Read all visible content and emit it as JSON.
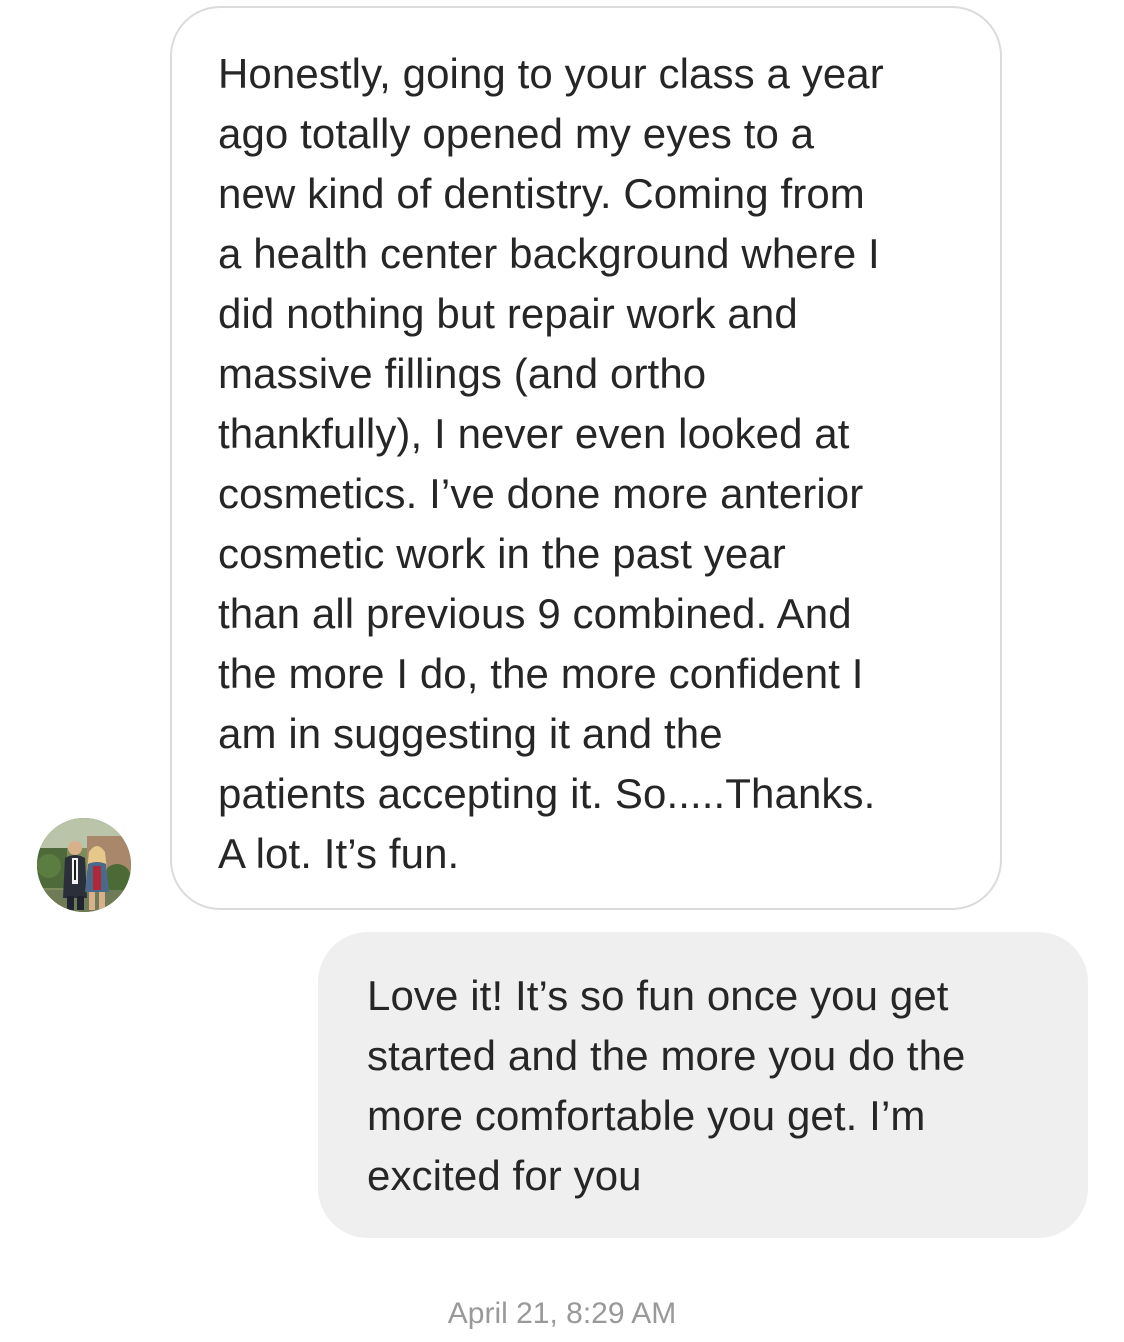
{
  "thread": {
    "incoming_message": {
      "text": "Honestly, going to your class a year\nago totally opened my eyes to a\nnew kind of dentistry. Coming from\na health center background where I\ndid nothing but repair work and\nmassive fillings (and ortho\nthankfully), I never even looked at\ncosmetics. I’ve done more anterior\ncosmetic work in the past year\nthan all previous 9 combined. And\nthe more I do, the more confident I\nam in suggesting it and the\npatients accepting it. So.....Thanks.\nA lot. It’s fun."
    },
    "outgoing_message": {
      "text": "Love it! It’s so fun once you get\nstarted and the more you do the\nmore comfortable you get. I’m\nexcited for you"
    },
    "timestamp": "April 21, 8:29 AM"
  },
  "colors": {
    "incoming_bubble_border": "#dbdbdb",
    "outgoing_bubble_bg": "#efefef",
    "text": "#262626",
    "timestamp": "#999999"
  }
}
